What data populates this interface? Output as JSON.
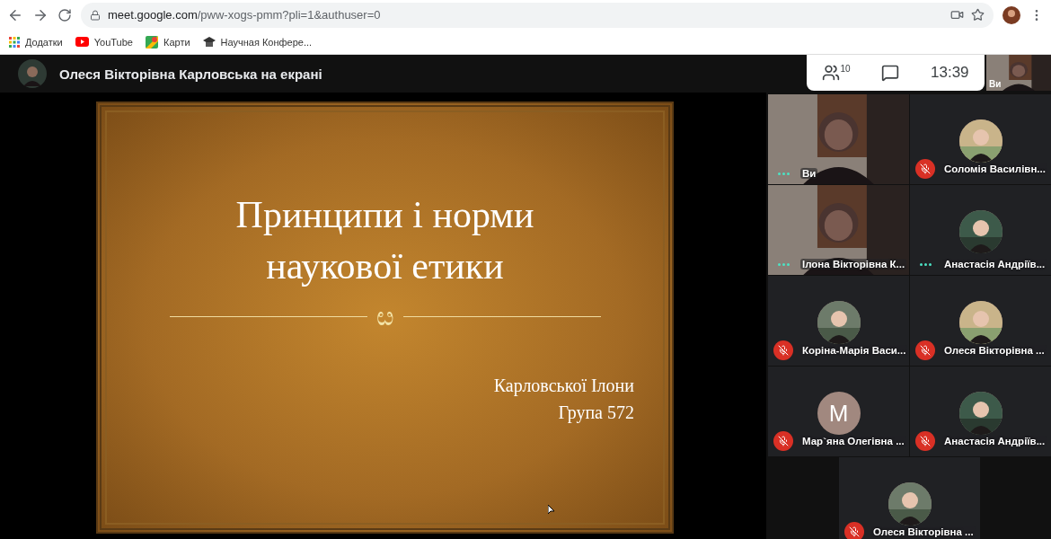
{
  "browser": {
    "url_host": "meet.google.com",
    "url_path": "/pww-xogs-pmm?pli=1&authuser=0"
  },
  "bookmarks": [
    {
      "kind": "apps",
      "label": "Додатки"
    },
    {
      "kind": "youtube",
      "label": "YouTube"
    },
    {
      "kind": "maps",
      "label": "Карти"
    },
    {
      "kind": "site",
      "label": "Научная Конфере..."
    }
  ],
  "presenter": {
    "title": "Олеся Вікторівна Карловська на екрані"
  },
  "top_panel": {
    "people_count": "10",
    "time": "13:39"
  },
  "self_view": {
    "name": "Ви"
  },
  "slide": {
    "title_lines": [
      "Принципи і норми",
      "наукової етики"
    ],
    "ornament": "ೞ",
    "author_lines": [
      "Карловської Ілони",
      "Група 572"
    ]
  },
  "participants": [
    {
      "name": "Ви",
      "kind": "video",
      "muted": false
    },
    {
      "name": "Соломія Василівн...",
      "muted": true
    },
    {
      "name": "Ілона Вікторівна К...",
      "kind": "video",
      "muted": false
    },
    {
      "name": "Анастасія Андріїв...",
      "muted": false
    },
    {
      "name": "Коріна-Марія Васи...",
      "muted": true
    },
    {
      "name": "Олеся Вікторівна ...",
      "muted": true
    },
    {
      "name": "Мар`яна Олегівна ...",
      "kind": "letter",
      "letter": "M",
      "muted": true
    },
    {
      "name": "Анастасія Андріїв...",
      "muted": true
    },
    {
      "name": "Олеся Вікторівна ...",
      "muted": true
    }
  ]
}
